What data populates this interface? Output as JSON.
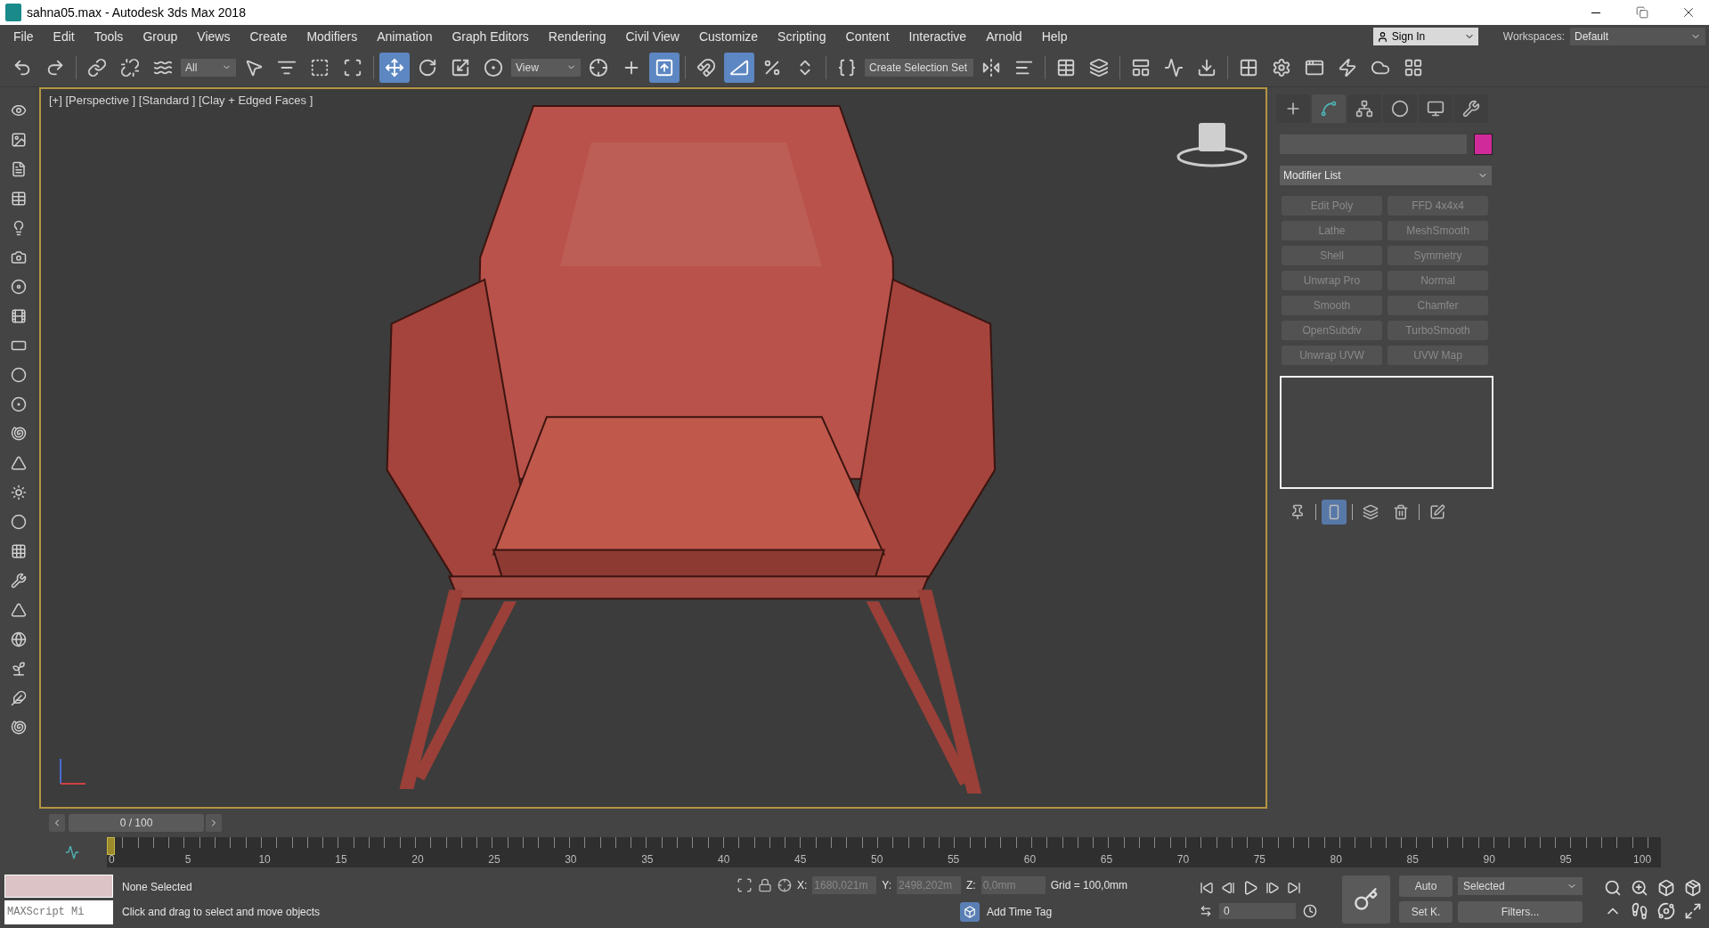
{
  "window": {
    "title": "sahna05.max - Autodesk 3ds Max 2018"
  },
  "menu": [
    "File",
    "Edit",
    "Tools",
    "Group",
    "Views",
    "Create",
    "Modifiers",
    "Animation",
    "Graph Editors",
    "Rendering",
    "Civil View",
    "Customize",
    "Scripting",
    "Content",
    "Interactive",
    "Arnold",
    "Help"
  ],
  "account": {
    "label": "Sign In"
  },
  "workspaces": {
    "label": "Workspaces:",
    "value": "Default"
  },
  "toolbar": {
    "selection_filter": "All",
    "reference_coordinate": "View",
    "selection_set": "Create Selection Set",
    "tools": [
      {
        "selected": false
      },
      {
        "selected": false
      },
      {
        "selected": false
      },
      {
        "selected": false
      },
      {
        "selected": false
      },
      {
        "selected": false
      },
      {
        "selected": false
      },
      {
        "selected": false
      },
      {
        "selected": false
      },
      {
        "selected": true
      },
      {
        "selected": false
      },
      {
        "selected": false
      },
      {
        "selected": false
      },
      {
        "selected": false
      },
      {
        "selected": false
      },
      {
        "selected": true
      },
      {
        "selected": false
      },
      {
        "selected": true
      },
      {
        "selected": false
      },
      {
        "selected": false
      },
      {
        "selected": false
      },
      {
        "selected": false
      },
      {
        "selected": false
      },
      {
        "selected": false
      },
      {
        "selected": false
      },
      {
        "selected": false
      },
      {
        "selected": false
      },
      {
        "selected": false
      },
      {
        "selected": false
      },
      {
        "selected": false
      },
      {
        "selected": false
      },
      {
        "selected": false
      },
      {
        "selected": false
      },
      {
        "selected": false
      }
    ]
  },
  "viewport": {
    "label": "[+] [Perspective ] [Standard ] [Clay + Edged Faces ]"
  },
  "command_panel": {
    "tabs": [
      {
        "selected": false
      },
      {
        "selected": true
      },
      {
        "selected": false
      },
      {
        "selected": false
      },
      {
        "selected": false
      },
      {
        "selected": false
      }
    ],
    "modifier_list": "Modifier List",
    "modifiers": [
      {
        "label": "Edit Poly",
        "disabled": true
      },
      {
        "label": "FFD 4x4x4",
        "disabled": true
      },
      {
        "label": "Lathe",
        "disabled": true
      },
      {
        "label": "MeshSmooth",
        "disabled": true
      },
      {
        "label": "Shell",
        "disabled": true
      },
      {
        "label": "Symmetry",
        "disabled": true
      },
      {
        "label": "Unwrap Pro",
        "disabled": true
      },
      {
        "label": "Normal",
        "disabled": true
      },
      {
        "label": "Smooth",
        "disabled": true
      },
      {
        "label": "Chamfer",
        "disabled": true
      },
      {
        "label": "OpenSubdiv",
        "disabled": true
      },
      {
        "label": "TurboSmooth",
        "disabled": true
      },
      {
        "label": "Unwrap UVW",
        "disabled": true
      },
      {
        "label": "UVW Map",
        "disabled": true
      }
    ],
    "stack_tools": [
      {
        "selected": false
      },
      {
        "selected": true
      },
      {
        "selected": false
      },
      {
        "selected": false
      },
      {
        "selected": false
      }
    ]
  },
  "time_slider": {
    "label": "0 / 100",
    "level": 0
  },
  "ruler": {
    "ticks": [
      "0",
      "5",
      "10",
      "15",
      "20",
      "25",
      "30",
      "35",
      "40",
      "45",
      "50",
      "55",
      "60",
      "65",
      "70",
      "75",
      "80",
      "85",
      "90",
      "95",
      "100"
    ]
  },
  "status": {
    "maxscript": "MAXScript Mi",
    "selection": "None Selected",
    "prompt": "Click and drag to select and move objects",
    "x_label": "X:",
    "x_value": "1680,021m",
    "y_label": "Y:",
    "y_value": "2498,202m",
    "z_label": "Z:",
    "z_value": "0,0mm",
    "grid": "Grid = 100,0mm",
    "time_tag": "Add Time Tag",
    "frame": "0"
  },
  "keying": {
    "auto": "Auto",
    "set_key": "Set K.",
    "key_set": "Selected",
    "filters": "Filters..."
  }
}
